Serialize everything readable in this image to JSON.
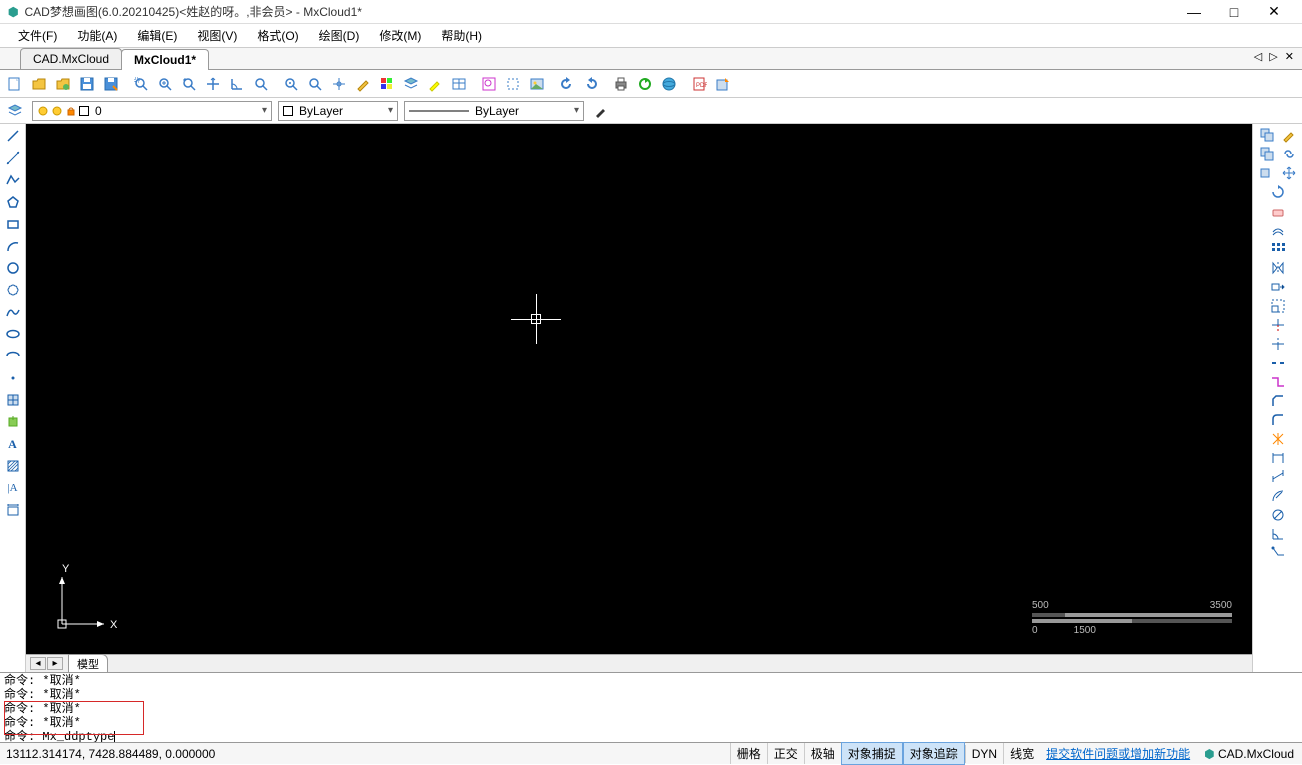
{
  "window": {
    "title": "CAD梦想画图(6.0.20210425)<姓赵的呀。,非会员> - MxCloud1*"
  },
  "menu": {
    "file": "文件(F)",
    "function": "功能(A)",
    "edit": "编辑(E)",
    "view": "视图(V)",
    "format": "格式(O)",
    "draw": "绘图(D)",
    "modify": "修改(M)",
    "help": "帮助(H)"
  },
  "tabs": {
    "tab1": "CAD.MxCloud",
    "tab2": "MxCloud1*",
    "ctrl": "◁ ▷ ✕"
  },
  "layer_bar": {
    "layer_value": "0",
    "color_value": "ByLayer",
    "linetype_value": "ByLayer"
  },
  "canvas": {
    "ucs_y": "Y",
    "ucs_x": "X",
    "scale_top_left": "500",
    "scale_top_right": "3500",
    "scale_bot_left": "0",
    "scale_bot_right": "1500",
    "model_tab": "模型"
  },
  "command": {
    "l1": "命令:  *取消*",
    "l2": "命令:  *取消*",
    "l3": "命令:  *取消*",
    "l4": "命令:  *取消*",
    "l5_prefix": "命令: ",
    "l5_cmd": "Mx_ddptype"
  },
  "status": {
    "coords": "13112.314174,  7428.884489,  0.000000",
    "grid": "栅格",
    "ortho": "正交",
    "polar": "极轴",
    "osnap": "对象捕捉",
    "otrack": "对象追踪",
    "dyn": "DYN",
    "lwt": "线宽",
    "feedback": "提交软件问题或增加新功能",
    "brand": "CAD.MxCloud"
  }
}
